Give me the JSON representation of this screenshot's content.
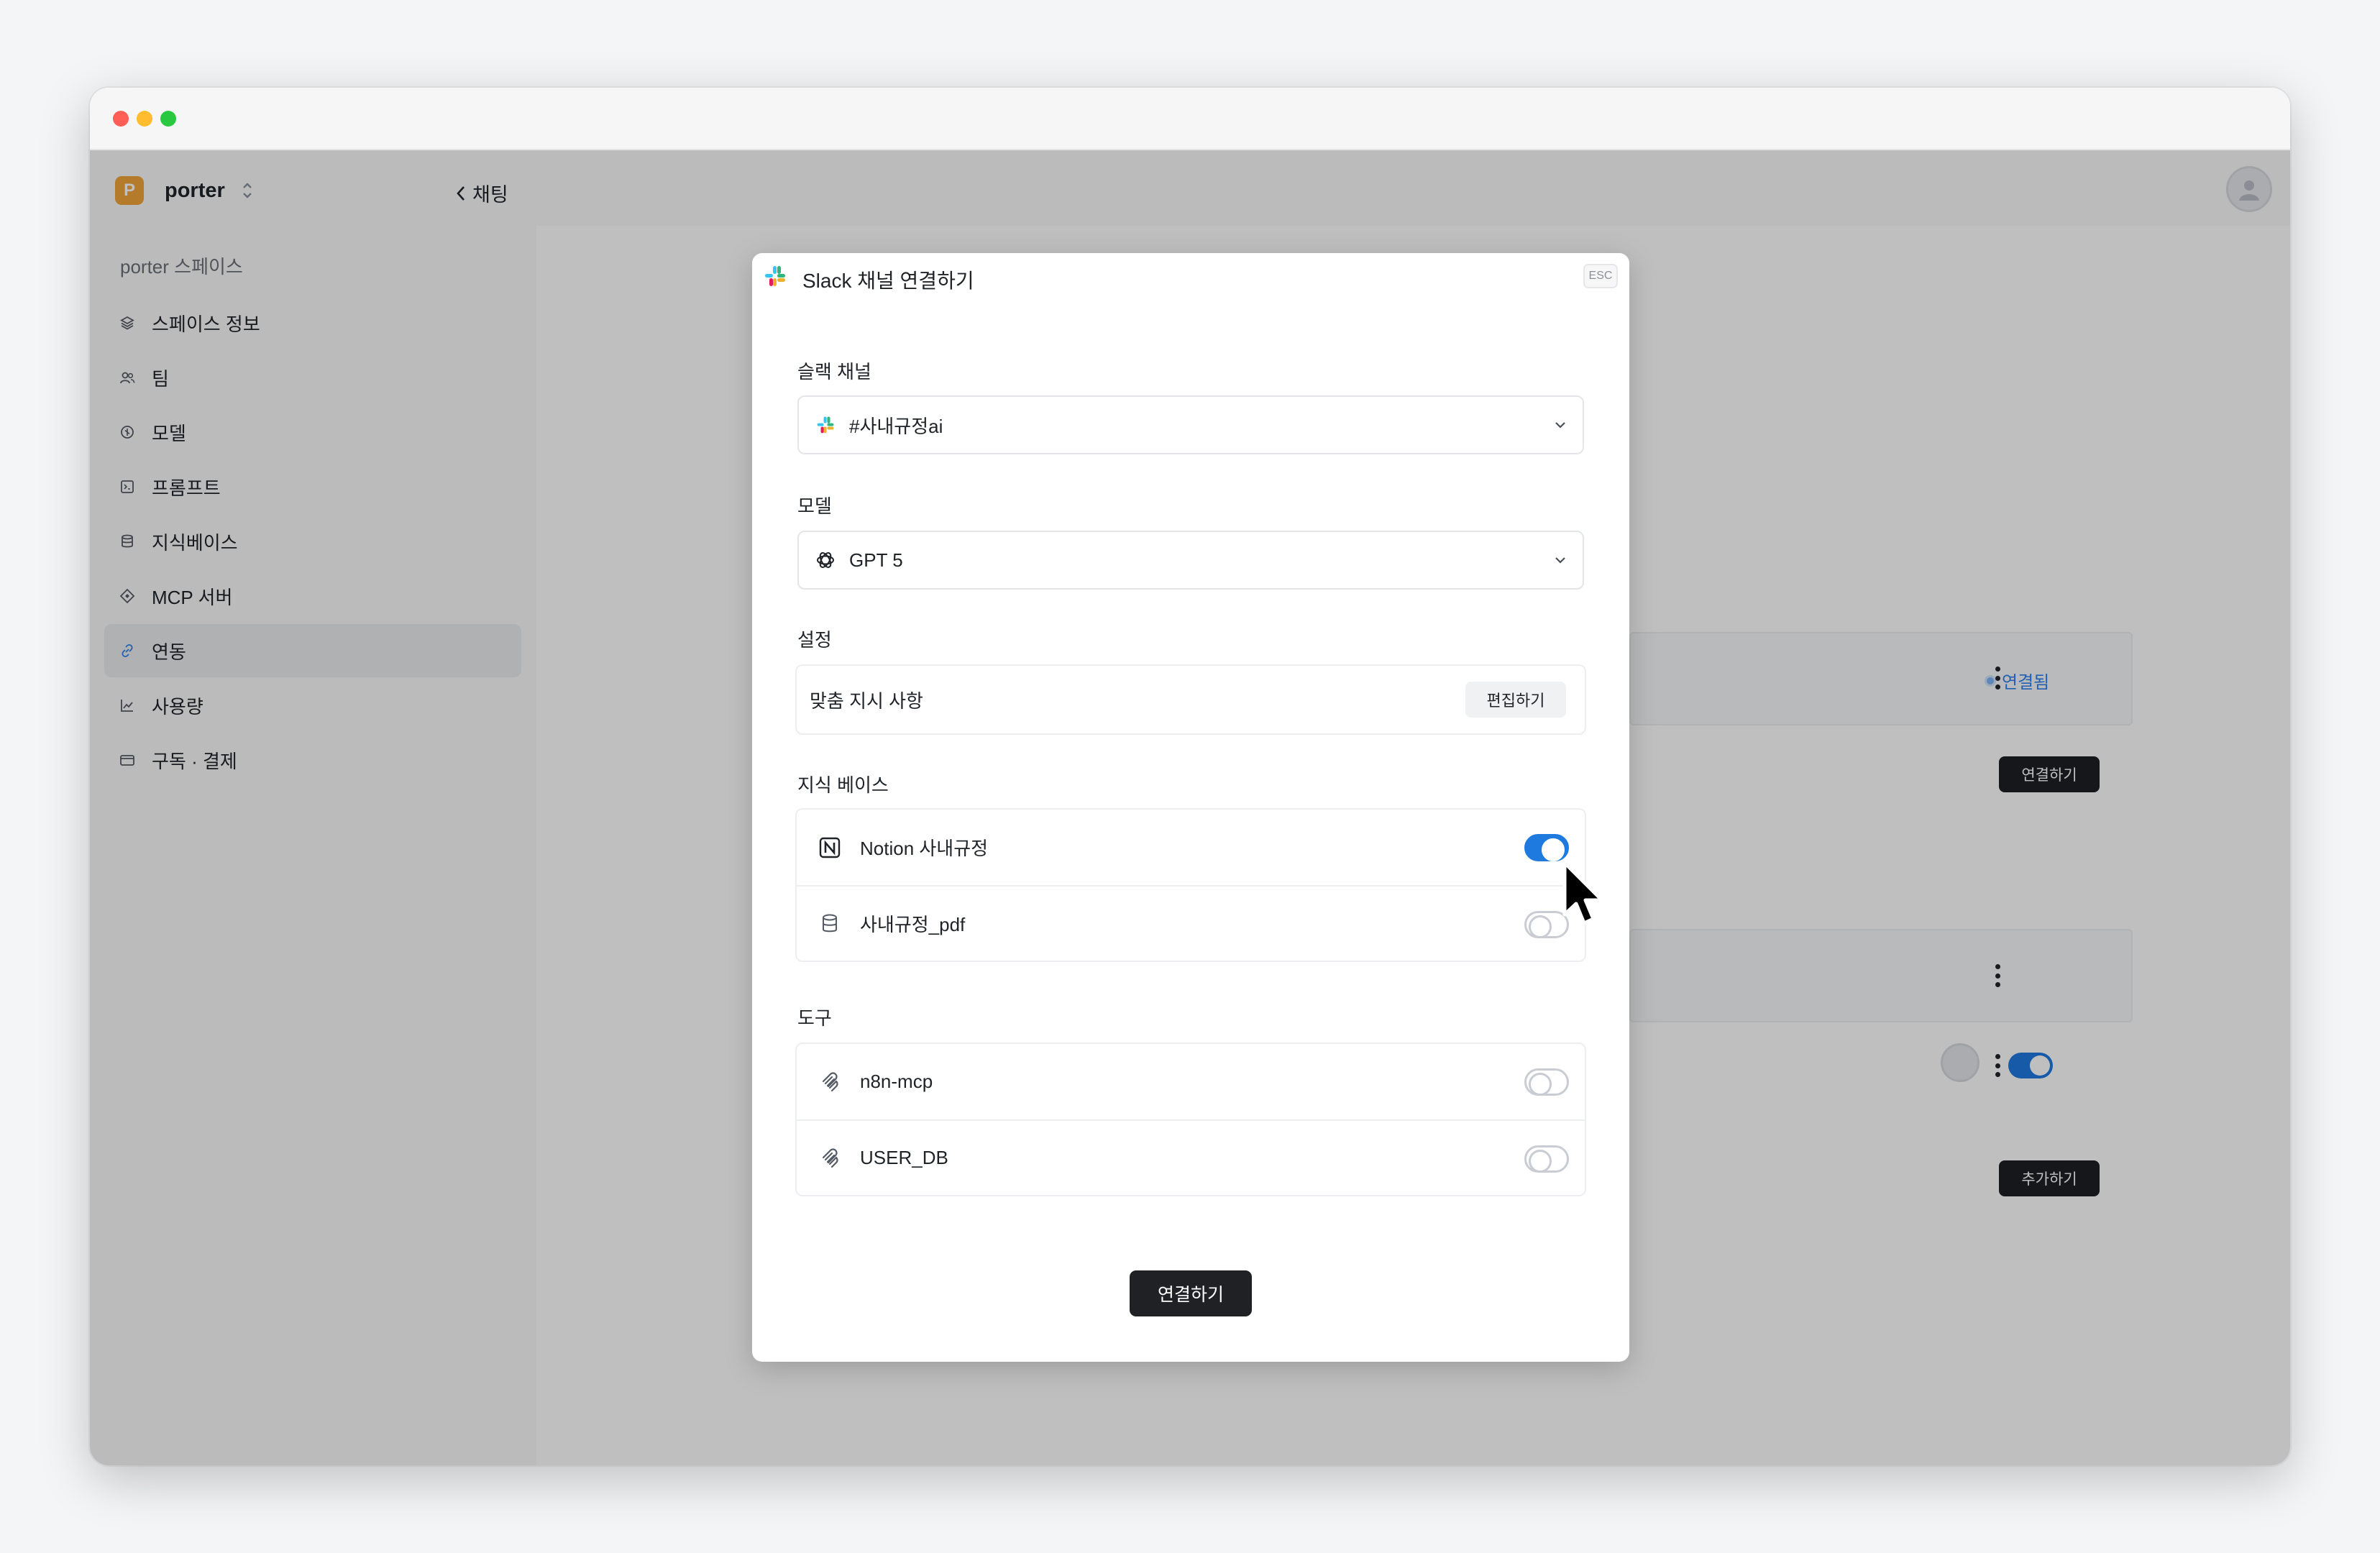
{
  "sidebar": {
    "workspace_initial": "P",
    "workspace_name": "porter",
    "back_label": "채팅",
    "space_title": "porter 스페이스",
    "items": [
      {
        "label": "스페이스 정보",
        "icon": "layers-icon"
      },
      {
        "label": "팀",
        "icon": "users-icon"
      },
      {
        "label": "모델",
        "icon": "model-icon"
      },
      {
        "label": "프롬프트",
        "icon": "prompt-icon"
      },
      {
        "label": "지식베이스",
        "icon": "database-icon"
      },
      {
        "label": "MCP 서버",
        "icon": "mcp-icon"
      },
      {
        "label": "연동",
        "icon": "link-icon",
        "active": true
      },
      {
        "label": "사용량",
        "icon": "chart-icon"
      },
      {
        "label": "구독 · 결제",
        "icon": "card-icon"
      }
    ]
  },
  "background": {
    "status_connected": "연결됨",
    "connect_label": "연결하기",
    "add_label": "추가하기"
  },
  "modal": {
    "title": "Slack 채널 연결하기",
    "esc_label": "ESC",
    "channel_label": "슬랙 채널",
    "channel_value": "#사내규정ai",
    "model_label": "모델",
    "model_value": "GPT 5",
    "settings_label": "설정",
    "custom_instructions": "맞춤 지시 사항",
    "edit_label": "편집하기",
    "kb_label": "지식 베이스",
    "kb_items": [
      {
        "label": "Notion 사내규정",
        "enabled": true
      },
      {
        "label": "사내규정_pdf",
        "enabled": false
      }
    ],
    "tools_label": "도구",
    "tool_items": [
      {
        "label": "n8n-mcp",
        "enabled": false
      },
      {
        "label": "USER_DB",
        "enabled": false
      }
    ],
    "submit_label": "연결하기"
  },
  "colors": {
    "accent": "#1f7ae0",
    "workspace_badge": "#f0a53a",
    "dark_button": "#1f2124"
  }
}
